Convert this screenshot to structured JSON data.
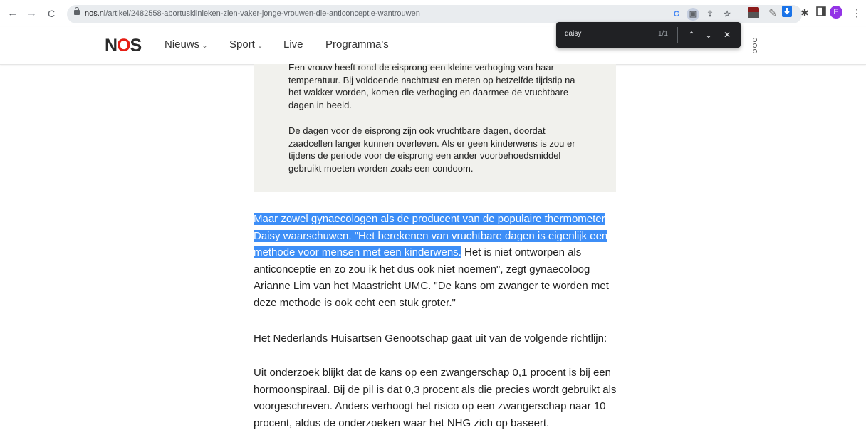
{
  "browser": {
    "url_host": "nos.nl",
    "url_path": "/artikel/2482558-abortusklinieken-zien-vaker-jonge-vrouwen-die-anticonceptie-wantrouwen",
    "back_icon": "←",
    "forward_icon": "→",
    "reload_icon": "C",
    "profile_initial": "E",
    "ext_badge": "134"
  },
  "findbar": {
    "query": "daisy",
    "count": "1/1"
  },
  "site": {
    "logo_parts": [
      "N",
      "O",
      "S"
    ],
    "nav": [
      {
        "label": "Nieuws"
      },
      {
        "label": "Sport"
      },
      {
        "label": "Live"
      },
      {
        "label": "Programma's"
      }
    ]
  },
  "infobox": {
    "p1": "Een vrouw heeft rond de eisprong een kleine verhoging van haar temperatuur. Bij voldoende nachtrust en meten op hetzelfde tijdstip na het wakker worden, komen die verhoging en daarmee de vruchtbare dagen in beeld.",
    "p2": "De dagen voor de eisprong zijn ook vruchtbare dagen, doordat zaadcellen langer kunnen overleven. Als er geen kinderwens is zou er tijdens de periode voor de eisprong een ander voorbehoedsmiddel gebruikt moeten worden zoals een condoom."
  },
  "article": {
    "p1_highlight": "Maar zowel gynaecologen als de producent van de populaire thermometer Daisy waarschuwen. \"Het berekenen van vruchtbare dagen is eigenlijk een methode voor mensen met een kinderwens.",
    "p1_rest": " Het is niet ontworpen als anticonceptie en zo zou ik het dus ook niet noemen\", zegt gynaecoloog Arianne Lim van het Maastricht UMC. \"De kans om zwanger te worden met deze methode is ook echt een stuk groter.\"",
    "p2": "Het Nederlands Huisartsen Genootschap gaat uit van de volgende richtlijn:",
    "p3": "Uit onderzoek blijkt dat de kans op een zwangerschap 0,1 procent is bij een hormoonspiraal. Bij de pil is dat 0,3 procent als die precies wordt gebruikt als voorgeschreven. Anders verhoogt het risico op een zwangerschap naar 10 procent, aldus de onderzoeken waar het NHG zich op baseert."
  },
  "colors": {
    "highlight": "#3d8ef7",
    "logo_red": "#e61e14",
    "infobox_bg": "#f1f1ed"
  }
}
